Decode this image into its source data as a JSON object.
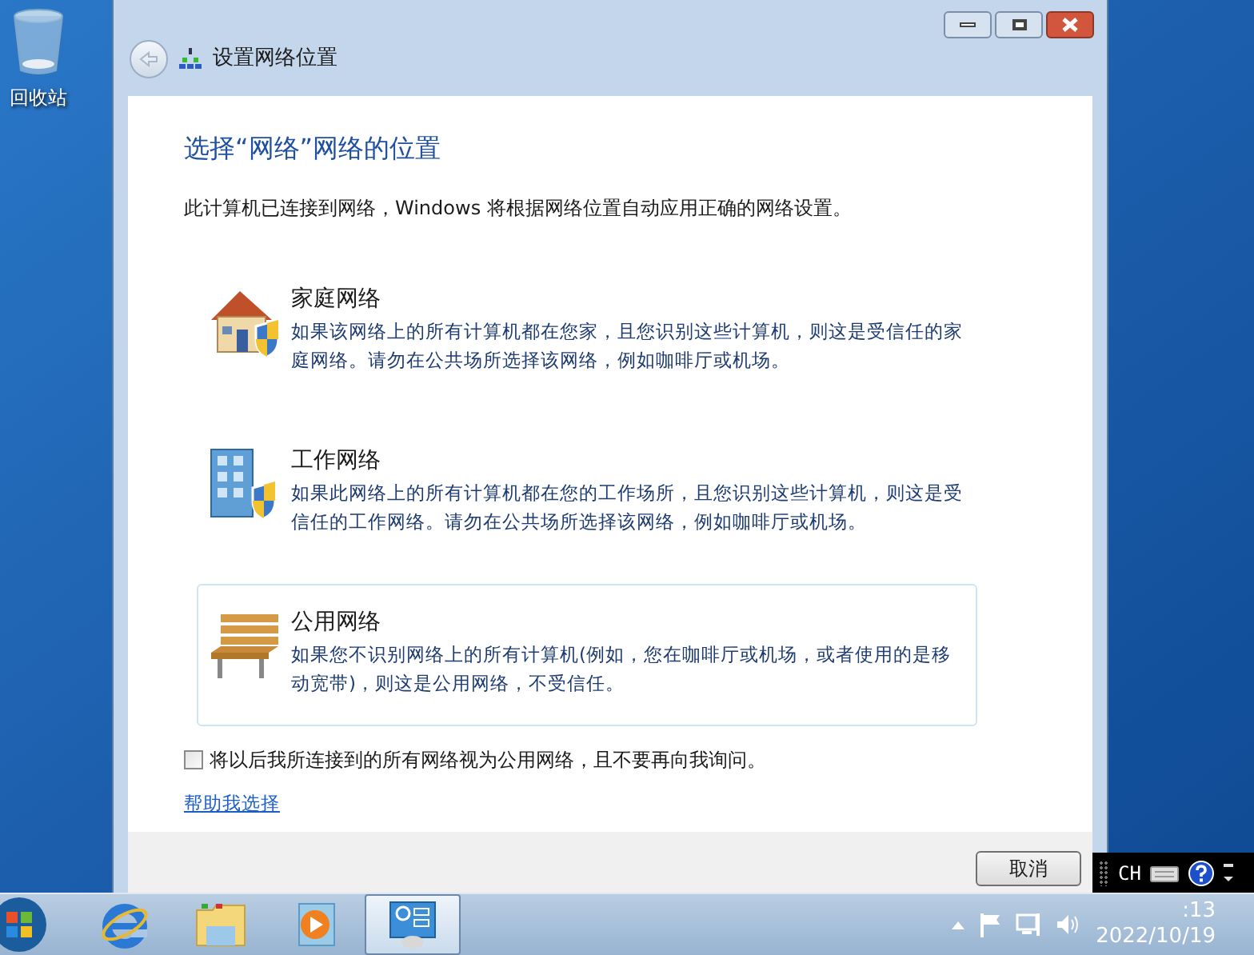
{
  "desktop": {
    "icons": [
      {
        "label": "回收站"
      }
    ]
  },
  "window": {
    "title": "设置网络位置",
    "heading": "选择“网络”网络的位置",
    "intro": "此计算机已连接到网络，Windows 将根据网络位置自动应用正确的网络设置。",
    "options": [
      {
        "kind": "home",
        "title": "家庭网络",
        "description": "如果该网络上的所有计算机都在您家，且您识别这些计算机，则这是受信任的家庭网络。请勿在公共场所选择该网络，例如咖啡厅或机场。",
        "selected": false
      },
      {
        "kind": "work",
        "title": "工作网络",
        "description": "如果此网络上的所有计算机都在您的工作场所，且您识别这些计算机，则这是受信任的工作网络。请勿在公共场所选择该网络，例如咖啡厅或机场。",
        "selected": false
      },
      {
        "kind": "public",
        "title": "公用网络",
        "description": "如果您不识别网络上的所有计算机(例如，您在咖啡厅或机场，或者使用的是移动宽带)，则这是公用网络，不受信任。",
        "selected": true
      }
    ],
    "checkbox": {
      "label": "将以后我所连接到的所有网络视为公用网络，且不要再向我询问。",
      "checked": false
    },
    "help_link": "帮助我选择",
    "buttons": [
      "取消"
    ]
  },
  "language_bar": {
    "label": "CH"
  },
  "taskbar": {
    "apps": [
      {
        "kind": "browser",
        "active": false
      },
      {
        "kind": "folder",
        "active": false
      },
      {
        "kind": "media",
        "active": false
      },
      {
        "kind": "control",
        "active": true
      }
    ],
    "clock": {
      "time": ":13",
      "date": "2022/10/19"
    }
  }
}
